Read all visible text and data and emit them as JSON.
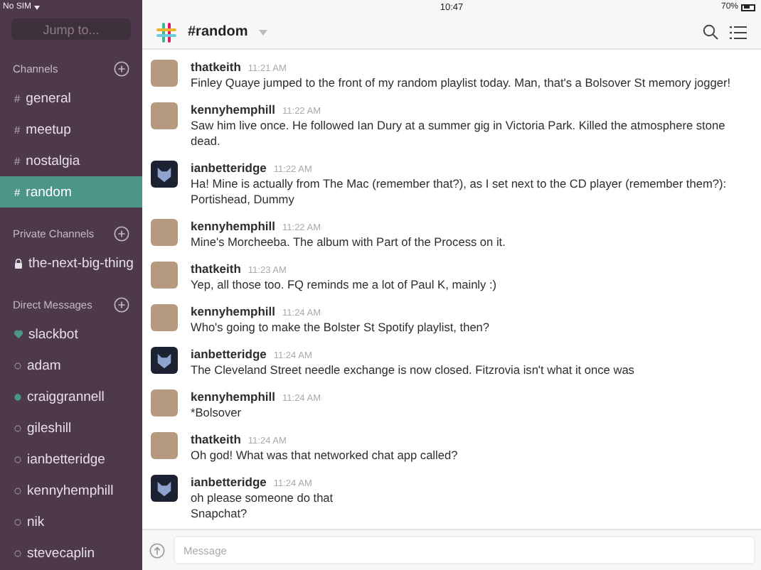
{
  "status_bar": {
    "carrier": "No SIM",
    "time": "10:47",
    "battery": "70%"
  },
  "sidebar": {
    "search": {
      "placeholder": "Jump to..."
    },
    "sections": [
      {
        "title": "Channels",
        "kind": "channels",
        "items": [
          {
            "mark": "#",
            "name": "general",
            "selected": false
          },
          {
            "mark": "#",
            "name": "meetup",
            "selected": false
          },
          {
            "mark": "#",
            "name": "nostalgia",
            "selected": false
          },
          {
            "mark": "#",
            "name": "random",
            "selected": true
          }
        ]
      },
      {
        "title": "Private Channels",
        "kind": "private",
        "items": [
          {
            "name": "the-next-big-thing",
            "selected": false
          }
        ]
      },
      {
        "title": "Direct Messages",
        "kind": "dms",
        "items": [
          {
            "name": "slackbot",
            "selected": false,
            "kind": "bot",
            "online": true
          },
          {
            "name": "adam",
            "selected": false,
            "kind": "user",
            "online": false
          },
          {
            "name": "craiggrannell",
            "selected": false,
            "kind": "user",
            "online": true
          },
          {
            "name": "gileshill",
            "selected": false,
            "kind": "user",
            "online": false
          },
          {
            "name": "ianbetteridge",
            "selected": false,
            "kind": "user",
            "online": false
          },
          {
            "name": "kennyhemphill",
            "selected": false,
            "kind": "user",
            "online": false
          },
          {
            "name": "nik",
            "selected": false,
            "kind": "user",
            "online": false
          },
          {
            "name": "stevecaplin",
            "selected": false,
            "kind": "user",
            "online": false
          }
        ]
      }
    ]
  },
  "header": {
    "title": "#random"
  },
  "messages": [
    {
      "author": "thatkeith",
      "time": "11:21 AM",
      "kind": "photo",
      "lines": [
        "Finley Quaye jumped to the front of my random playlist today. Man, that's a Bolsover St memory jogger!"
      ]
    },
    {
      "author": "kennyhemphill",
      "time": "11:22 AM",
      "kind": "photo",
      "lines": [
        "Saw him live once. He followed Ian Dury at a summer gig in Victoria Park. Killed the atmosphere stone dead."
      ]
    },
    {
      "author": "ianbetteridge",
      "time": "11:22 AM",
      "kind": "cat",
      "lines": [
        "Ha! Mine is actually from The Mac (remember that?), as I set next to the CD player (remember them?): Portishead, Dummy"
      ]
    },
    {
      "author": "kennyhemphill",
      "time": "11:22 AM",
      "kind": "photo",
      "lines": [
        "Mine's Morcheeba. The album with Part of the Process on it."
      ]
    },
    {
      "author": "thatkeith",
      "time": "11:23 AM",
      "kind": "photo",
      "lines": [
        "Yep, all those too. FQ reminds me a lot of Paul K, mainly :)"
      ]
    },
    {
      "author": "kennyhemphill",
      "time": "11:24 AM",
      "kind": "photo",
      "lines": [
        "Who's going to make the Bolster St Spotify playlist, then?"
      ]
    },
    {
      "author": "ianbetteridge",
      "time": "11:24 AM",
      "kind": "cat",
      "lines": [
        "The Cleveland Street needle exchange is now closed. Fitzrovia isn't what it once was"
      ]
    },
    {
      "author": "kennyhemphill",
      "time": "11:24 AM",
      "kind": "photo",
      "lines": [
        "*Bolsover"
      ]
    },
    {
      "author": "thatkeith",
      "time": "11:24 AM",
      "kind": "photo",
      "lines": [
        "Oh god! What was that networked chat app called?"
      ]
    },
    {
      "author": "ianbetteridge",
      "time": "11:24 AM",
      "kind": "cat",
      "lines": [
        "oh please someone do that",
        "Snapchat?"
      ]
    }
  ],
  "composer": {
    "placeholder": "Message"
  }
}
